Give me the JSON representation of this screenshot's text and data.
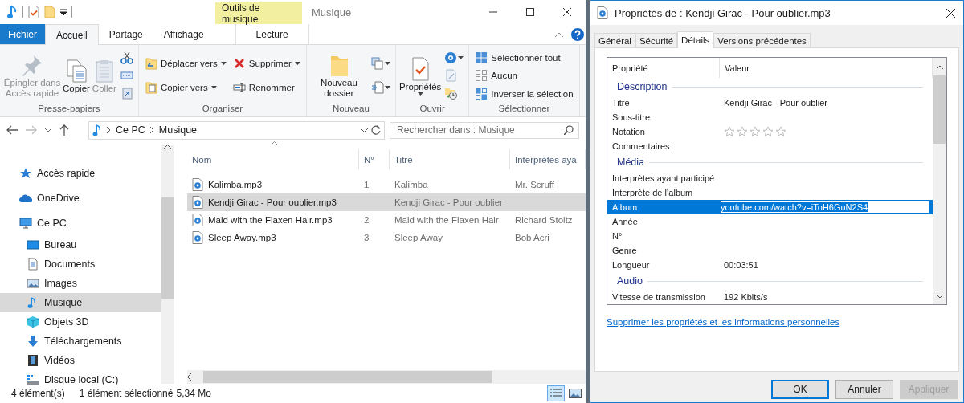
{
  "explorer": {
    "title": "Musique",
    "contextual_group": "Outils de musique",
    "ribbon_tabs": [
      {
        "label": "Fichier",
        "kind": "file",
        "selected": false
      },
      {
        "label": "Accueil",
        "kind": "normal",
        "selected": true
      },
      {
        "label": "Partage",
        "kind": "normal",
        "selected": false
      },
      {
        "label": "Affichage",
        "kind": "normal",
        "selected": false
      },
      {
        "label": "Lecture",
        "kind": "contextual",
        "selected": false
      }
    ],
    "ribbon_groups": [
      {
        "label": "Presse-papiers",
        "columns": [
          [
            {
              "kind": "large",
              "label": "Épingler dans Accès rapide",
              "disabled": true,
              "dropdown": false
            }
          ],
          [
            {
              "kind": "large",
              "label": "Copier",
              "disabled": false,
              "dropdown": false
            }
          ],
          [
            {
              "kind": "large",
              "label": "Coller",
              "disabled": true,
              "dropdown": false
            }
          ],
          [
            {
              "kind": "icon",
              "disabled": false
            },
            {
              "kind": "icon",
              "disabled": false
            },
            {
              "kind": "icon",
              "disabled": false
            }
          ]
        ]
      },
      {
        "label": "Organiser",
        "columns": [
          [
            {
              "kind": "small",
              "label": "Déplacer vers",
              "disabled": false,
              "dropdown": true
            },
            {
              "kind": "small",
              "label": "Copier vers",
              "disabled": false,
              "dropdown": true
            }
          ],
          [
            {
              "kind": "small",
              "label": "Supprimer",
              "disabled": false,
              "dropdown": true
            },
            {
              "kind": "small",
              "label": "Renommer",
              "disabled": false,
              "dropdown": false
            }
          ]
        ]
      },
      {
        "label": "Nouveau",
        "columns": [
          [
            {
              "kind": "large",
              "label": "Nouveau dossier",
              "disabled": false,
              "dropdown": false
            }
          ],
          [
            {
              "kind": "icon",
              "disabled": false,
              "dropdown": true
            },
            {
              "kind": "icon",
              "disabled": false,
              "dropdown": true
            }
          ]
        ]
      },
      {
        "label": "Ouvrir",
        "columns": [
          [
            {
              "kind": "large",
              "label": "Propriétés",
              "disabled": false,
              "dropdown": true
            }
          ],
          [
            {
              "kind": "icon",
              "disabled": false,
              "dropdown": true
            },
            {
              "kind": "icon",
              "disabled": false,
              "dropdown": false
            },
            {
              "kind": "icon",
              "disabled": false,
              "dropdown": false
            }
          ]
        ]
      },
      {
        "label": "Sélectionner",
        "columns": [
          [
            {
              "kind": "small",
              "label": "Sélectionner tout",
              "disabled": false,
              "dropdown": false
            },
            {
              "kind": "small",
              "label": "Aucun",
              "disabled": false,
              "dropdown": false
            },
            {
              "kind": "small",
              "label": "Inverser la sélection",
              "disabled": false,
              "dropdown": false
            }
          ]
        ]
      }
    ],
    "address": [
      "Ce PC",
      "Musique"
    ],
    "search": {
      "placeholder": "Rechercher dans : Musique"
    },
    "nav_items": [
      {
        "label": "Accès rapide",
        "selected": false
      },
      {
        "label": "OneDrive",
        "selected": false
      },
      {
        "label": "Ce PC",
        "selected": false,
        "children": [
          {
            "label": "Bureau",
            "selected": false
          },
          {
            "label": "Documents",
            "selected": false
          },
          {
            "label": "Images",
            "selected": false
          },
          {
            "label": "Musique",
            "selected": true
          },
          {
            "label": "Objets 3D",
            "selected": false
          },
          {
            "label": "Téléchargements",
            "selected": false
          },
          {
            "label": "Vidéos",
            "selected": false
          },
          {
            "label": "Disque local (C:)",
            "selected": false
          }
        ]
      }
    ],
    "columns": [
      {
        "label": "Nom",
        "sorted": true
      },
      {
        "label": "N°",
        "sorted": false
      },
      {
        "label": "Titre",
        "sorted": false
      },
      {
        "label": "Interprètes aya",
        "sorted": false
      }
    ],
    "files": [
      {
        "name": "Kalimba.mp3",
        "number": "1",
        "title": "Kalimba",
        "artist": "Mr. Scruff",
        "selected": false
      },
      {
        "name": "Kendji Girac - Pour oublier.mp3",
        "title": "Kendji Girac - Pour oublier",
        "selected": true
      },
      {
        "name": "Maid with the Flaxen Hair.mp3",
        "number": "2",
        "title": "Maid with the Flaxen Hair",
        "artist": "Richard Stoltz",
        "selected": false
      },
      {
        "name": "Sleep Away.mp3",
        "number": "3",
        "title": "Sleep Away",
        "artist": "Bob Acri",
        "selected": false
      }
    ],
    "status_bar": {
      "count": "4 élément(s)",
      "selection": "1 élément sélectionné",
      "size": "5,34 Mo",
      "views": [
        {
          "selected": true
        },
        {
          "selected": false
        }
      ]
    }
  },
  "dialog": {
    "title": "Propriétés de : Kendji Girac - Pour oublier.mp3",
    "tabs": [
      {
        "label": "Général",
        "selected": false
      },
      {
        "label": "Sécurité",
        "selected": false
      },
      {
        "label": "Détails",
        "selected": true
      },
      {
        "label": "Versions précédentes",
        "selected": false
      }
    ],
    "columns": [
      "Propriété",
      "Valeur"
    ],
    "rows": [
      {
        "kind": "section",
        "label": "Description"
      },
      {
        "kind": "property",
        "label": "Titre",
        "value": "Kendji Girac - Pour oublier",
        "selected": false
      },
      {
        "kind": "property",
        "label": "Sous-titre",
        "selected": false
      },
      {
        "kind": "rating",
        "label": "Notation",
        "stars": 0,
        "selected": false
      },
      {
        "kind": "property",
        "label": "Commentaires",
        "selected": false
      },
      {
        "kind": "section",
        "label": "Média"
      },
      {
        "kind": "property",
        "label": "Interprètes ayant participé",
        "selected": false
      },
      {
        "kind": "property",
        "label": "Interprète de l’album",
        "selected": false
      },
      {
        "kind": "edit",
        "label": "Album",
        "value": "youtube.com/watch?v=iToH6GuN2S4",
        "selected": true
      },
      {
        "kind": "property",
        "label": "Année",
        "selected": false
      },
      {
        "kind": "property",
        "label": "N°",
        "selected": false
      },
      {
        "kind": "property",
        "label": "Genre",
        "selected": false
      },
      {
        "kind": "property",
        "label": "Longueur",
        "value": "00:03:51",
        "selected": false
      },
      {
        "kind": "section",
        "label": "Audio"
      },
      {
        "kind": "property",
        "label": "Vitesse de transmission",
        "value": "192 Kbits/s",
        "selected": false
      }
    ],
    "link": "Supprimer les propriétés et les informations personnelles",
    "buttons": [
      {
        "label": "OK",
        "kind": "default",
        "disabled": false
      },
      {
        "label": "Annuler",
        "kind": "normal",
        "disabled": false
      },
      {
        "label": "Appliquer",
        "kind": "normal",
        "disabled": true
      }
    ]
  }
}
